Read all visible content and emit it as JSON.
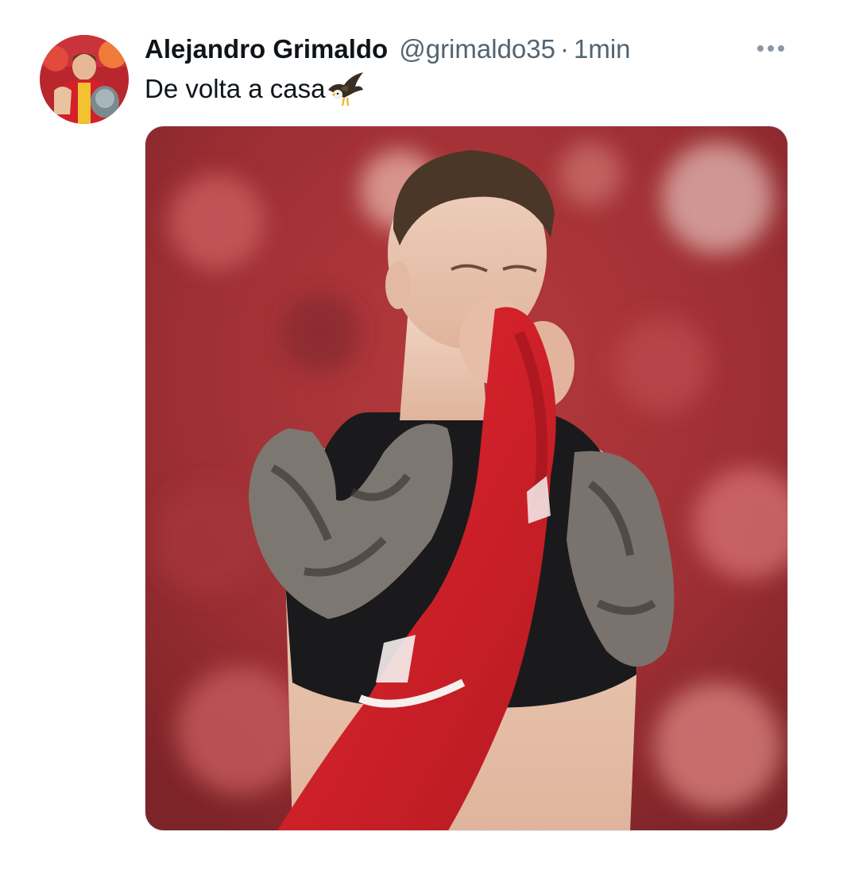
{
  "tweet": {
    "display_name": "Alejandro Grimaldo",
    "handle": "@grimaldo35",
    "separator": "·",
    "timestamp": "1min",
    "text": "De volta a casa",
    "emoji": "eagle-icon",
    "more_icon": "more-horizontal-icon"
  },
  "colors": {
    "name": "#0f1419",
    "meta": "#536471",
    "background": "#ffffff",
    "kit_red": "#d9202b"
  }
}
